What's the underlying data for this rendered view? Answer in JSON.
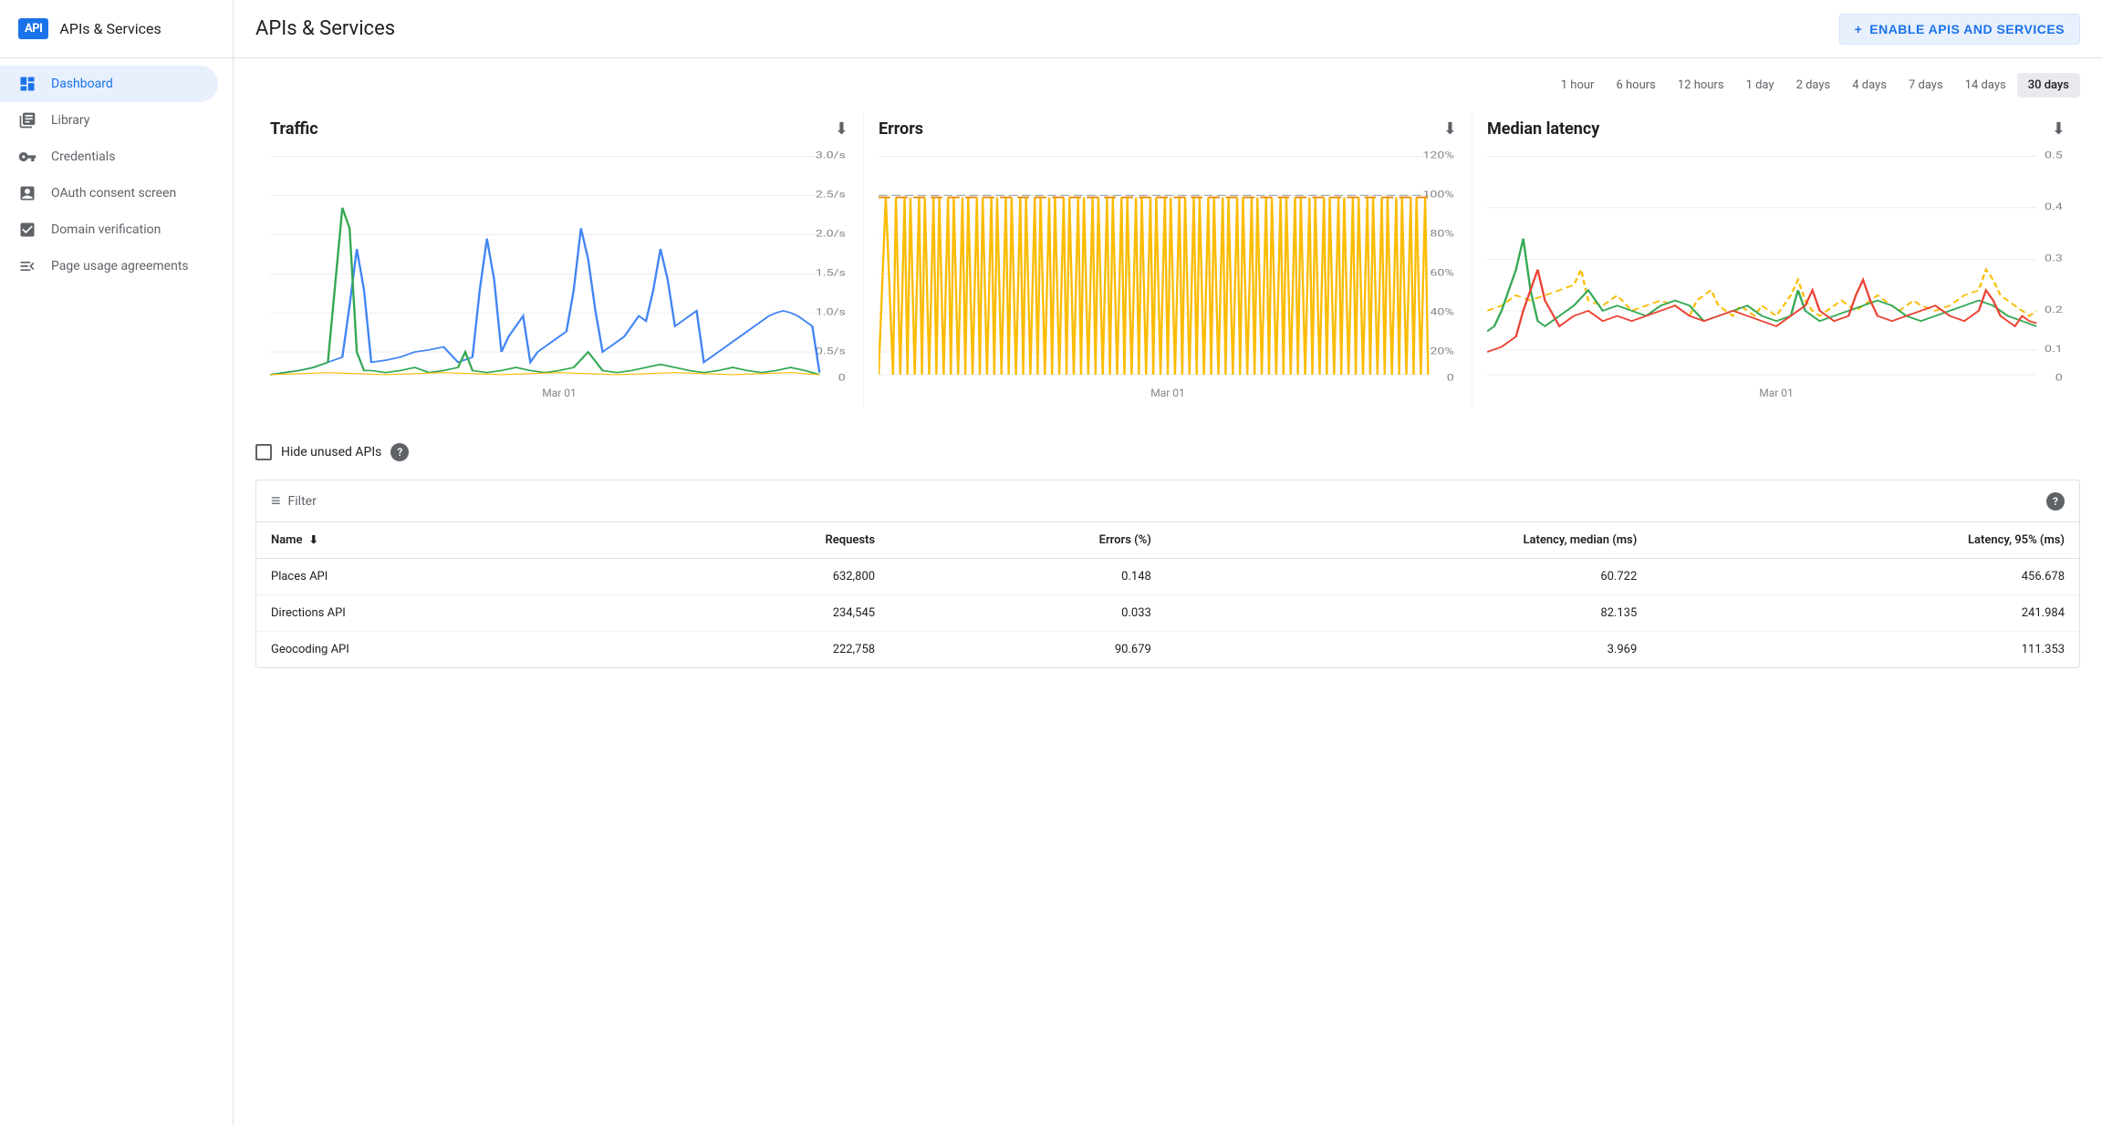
{
  "sidebar": {
    "logo": "API",
    "title": "APIs & Services",
    "nav_items": [
      {
        "id": "dashboard",
        "label": "Dashboard",
        "icon": "dashboard",
        "active": true
      },
      {
        "id": "library",
        "label": "Library",
        "icon": "library"
      },
      {
        "id": "credentials",
        "label": "Credentials",
        "icon": "credentials"
      },
      {
        "id": "oauth",
        "label": "OAuth consent screen",
        "icon": "oauth"
      },
      {
        "id": "domain",
        "label": "Domain verification",
        "icon": "domain"
      },
      {
        "id": "page-usage",
        "label": "Page usage agreements",
        "icon": "page-usage"
      }
    ]
  },
  "header": {
    "title": "APIs & Services",
    "enable_button": "ENABLE APIS AND SERVICES",
    "plus_label": "+"
  },
  "time_filters": [
    {
      "label": "1 hour",
      "active": false
    },
    {
      "label": "6 hours",
      "active": false
    },
    {
      "label": "12 hours",
      "active": false
    },
    {
      "label": "1 day",
      "active": false
    },
    {
      "label": "2 days",
      "active": false
    },
    {
      "label": "4 days",
      "active": false
    },
    {
      "label": "7 days",
      "active": false
    },
    {
      "label": "14 days",
      "active": false
    },
    {
      "label": "30 days",
      "active": true
    }
  ],
  "charts": [
    {
      "id": "traffic",
      "title": "Traffic",
      "x_label": "Mar 01",
      "y_labels": [
        "3.0/s",
        "2.5/s",
        "2.0/s",
        "1.5/s",
        "1.0/s",
        "0.5/s",
        "0"
      ]
    },
    {
      "id": "errors",
      "title": "Errors",
      "x_label": "Mar 01",
      "y_labels": [
        "120%",
        "100%",
        "80%",
        "60%",
        "40%",
        "20%",
        "0"
      ]
    },
    {
      "id": "median-latency",
      "title": "Median latency",
      "x_label": "Mar 01",
      "y_labels": [
        "0.5",
        "0.4",
        "0.3",
        "0.2",
        "0.1",
        "0"
      ]
    }
  ],
  "hide_unused": {
    "label": "Hide unused APIs",
    "help_icon": "?"
  },
  "table": {
    "filter_label": "Filter",
    "help_icon": "?",
    "columns": [
      {
        "id": "name",
        "label": "Name",
        "sortable": true
      },
      {
        "id": "requests",
        "label": "Requests",
        "sortable": true
      },
      {
        "id": "errors",
        "label": "Errors (%)",
        "sortable": false
      },
      {
        "id": "latency_median",
        "label": "Latency, median (ms)",
        "sortable": false
      },
      {
        "id": "latency_95",
        "label": "Latency, 95% (ms)",
        "sortable": false
      }
    ],
    "rows": [
      {
        "name": "Places API",
        "requests": "632,800",
        "errors": "0.148",
        "latency_median": "60.722",
        "latency_95": "456.678"
      },
      {
        "name": "Directions API",
        "requests": "234,545",
        "errors": "0.033",
        "latency_median": "82.135",
        "latency_95": "241.984"
      },
      {
        "name": "Geocoding API",
        "requests": "222,758",
        "errors": "90.679",
        "latency_median": "3.969",
        "latency_95": "111.353"
      }
    ]
  },
  "colors": {
    "active_nav_bg": "#e8f0fe",
    "active_nav_text": "#1a73e8",
    "active_time_bg": "#e8eaed",
    "brand_blue": "#1a73e8",
    "chart_blue": "#4285f4",
    "chart_green": "#34a853",
    "chart_orange": "#fbbc04",
    "chart_red": "#ea4335",
    "chart_dashed": "#9aa0a6"
  }
}
